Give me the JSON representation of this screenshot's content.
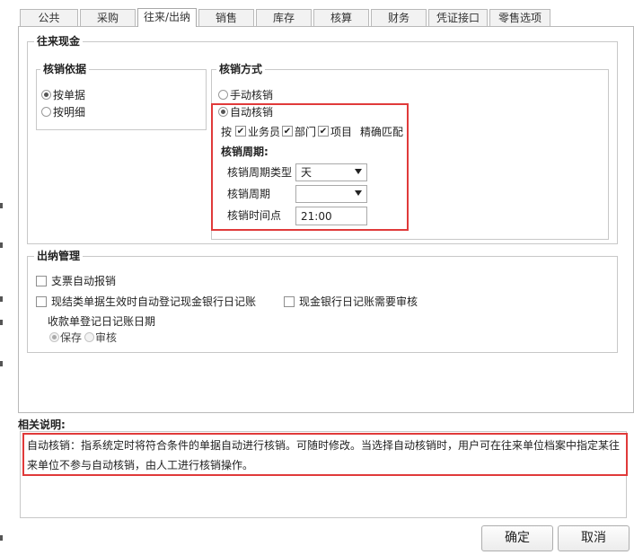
{
  "tabs": [
    "公共",
    "采购",
    "往来/出纳",
    "销售",
    "库存",
    "核算",
    "财务",
    "凭证接口",
    "零售选项"
  ],
  "active_tab": "往来/出纳",
  "cash_group": {
    "title": "往来现金",
    "basis": {
      "title": "核销依据",
      "options": [
        "按单据",
        "按明细"
      ],
      "selected": "按单据"
    },
    "method": {
      "title": "核销方式",
      "manual_label": "手动核销",
      "auto_label": "自动核销",
      "selected": "自动核销",
      "by_label": "按",
      "checks": [
        {
          "label": "业务员",
          "checked": true
        },
        {
          "label": "部门",
          "checked": true
        },
        {
          "label": "项目",
          "checked": true
        }
      ],
      "exact_match_label": "精确匹配",
      "cycle_title": "核销周期:",
      "cycle_type_label": "核销周期类型",
      "cycle_type_value": "天",
      "cycle_label": "核销周期",
      "cycle_value": "",
      "time_label": "核销时间点",
      "time_value": "21:00"
    }
  },
  "cashier_group": {
    "title": "出纳管理",
    "check_auto_report": {
      "label": "支票自动报销",
      "checked": false
    },
    "check_auto_register": {
      "label": "现结类单据生效时自动登记现金银行日记账",
      "checked": false
    },
    "check_need_audit": {
      "label": "现金银行日记账需要审核",
      "checked": false
    },
    "receipt_date_label": "收款单登记日记账日期",
    "receipt_options": [
      "保存",
      "审核"
    ],
    "receipt_selected": "保存"
  },
  "description": {
    "title": "相关说明:",
    "text": "自动核销：指系统定时将符合条件的单据自动进行核销。可随时修改。当选择自动核销时，用户可在往来单位档案中指定某往来单位不参与自动核销，由人工进行核销操作。"
  },
  "buttons": {
    "ok": "确定",
    "cancel": "取消"
  },
  "colors": {
    "highlight": "#e03a3a",
    "border": "#c8c8c8"
  }
}
